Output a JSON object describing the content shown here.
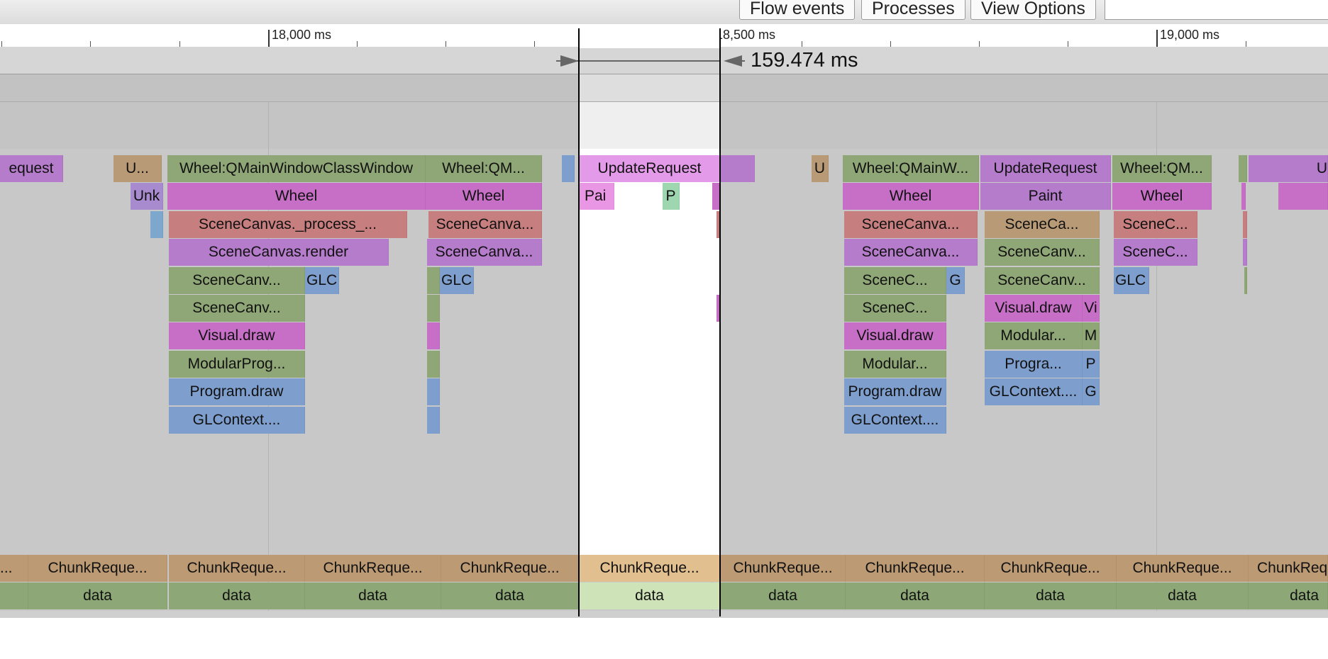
{
  "toolbar": {
    "flow_events": "Flow events",
    "processes": "Processes",
    "view_options": "View Options",
    "search_value": ""
  },
  "ruler": {
    "labels": [
      "18,000 ms",
      "18,500 ms",
      "19,000 ms"
    ]
  },
  "measurement": {
    "label": "159.474 ms"
  },
  "slices": {
    "row0": {
      "a": "equest",
      "b": "U...",
      "c": "Wheel:QMainWindowClassWindow",
      "d": "Wheel:QM...",
      "e": "UpdateRequest",
      "f": "U",
      "g": "Wheel:QMainW...",
      "h": "UpdateRequest",
      "i": "Wheel:QM...",
      "j": "U"
    },
    "row1": {
      "a": "Unk",
      "b": "Wheel",
      "c": "Wheel",
      "d": "Pai",
      "e": "P",
      "f": "Wheel",
      "g": "Paint",
      "h": "Wheel"
    },
    "row2": {
      "a": "SceneCanvas._process_...",
      "b": "SceneCanva...",
      "c": "SceneCanva...",
      "d": "SceneCa...",
      "e": "SceneC..."
    },
    "row3": {
      "a": "SceneCanvas.render",
      "b": "SceneCanva...",
      "c": "SceneCanva...",
      "d": "SceneCanv...",
      "e": "SceneC..."
    },
    "row4": {
      "a": "SceneCanv...",
      "b": "GLC",
      "c": "GLC",
      "d": "SceneC...",
      "e": "G",
      "f": "SceneCanv...",
      "g": "GLC"
    },
    "row5": {
      "a": "SceneCanv...",
      "b": "SceneC...",
      "c": "Visual.draw",
      "d": "Vi"
    },
    "row6": {
      "a": "Visual.draw",
      "b": "Visual.draw",
      "c": "Modular...",
      "d": "M"
    },
    "row7": {
      "a": "ModularProg...",
      "b": "Modular...",
      "c": "Progra...",
      "d": "P"
    },
    "row8": {
      "a": "Program.draw",
      "b": "Program.draw",
      "c": "GLContext....",
      "d": "G"
    },
    "row9": {
      "a": "GLContext....",
      "b": "GLContext...."
    }
  },
  "chunk_row": {
    "c0": "...",
    "c1": "ChunkReque...",
    "c2": "ChunkReque...",
    "c3": "ChunkReque...",
    "c4": "ChunkReque...",
    "c5": "ChunkReque...",
    "c6": "ChunkReque...",
    "c7": "ChunkReque...",
    "c8": "ChunkReque...",
    "c9": "ChunkReque...",
    "c10": "ChunkReq"
  },
  "data_row": {
    "label": "data"
  },
  "colors": {
    "purple": "#b57ccc",
    "magenta": "#c76fc6",
    "olive": "#8fa676",
    "tan": "#b89a76",
    "salmon": "#c77e7e",
    "blue": "#7e9ecd",
    "lilac": "#a88bcf",
    "pink": "#e39ae8",
    "mint": "#9ed6b0",
    "data_green": "#8da876",
    "data_selected": "#cfe3b8",
    "chunk_tan": "#bb9a74",
    "chunk_selected": "#e2bf8e"
  }
}
